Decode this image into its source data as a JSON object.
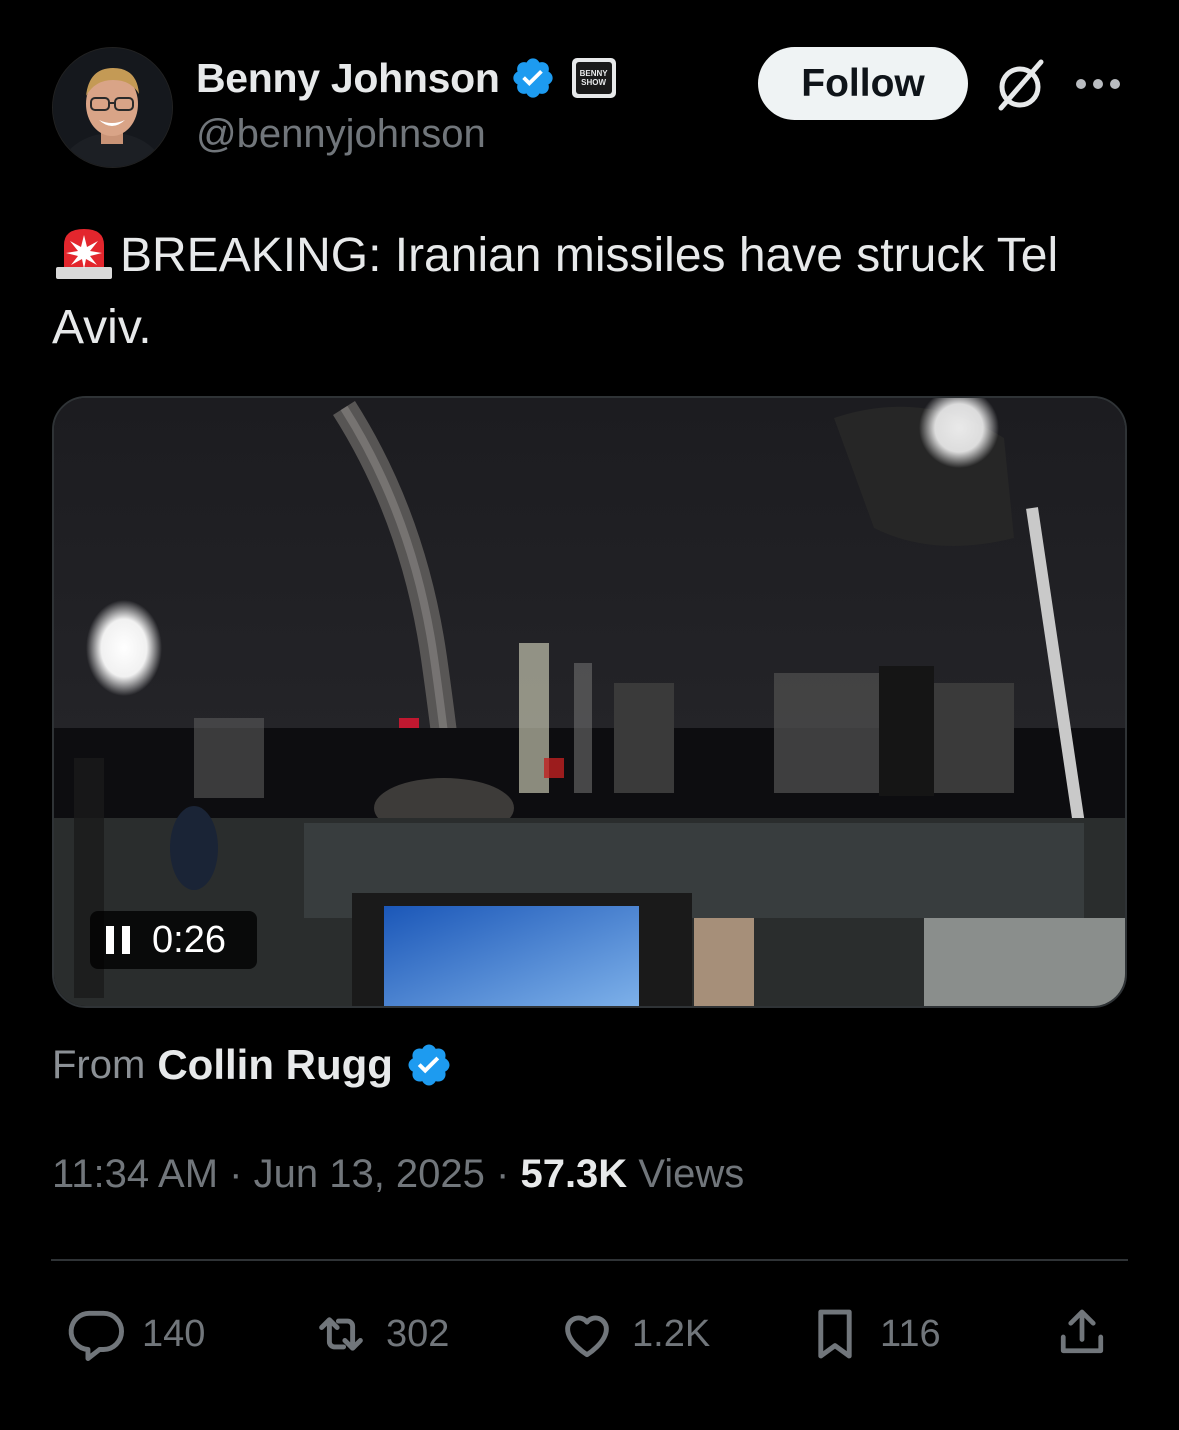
{
  "author": {
    "display_name": "Benny Johnson",
    "handle": "@bennyjohnson",
    "verified_icon": "verified-badge-icon",
    "affiliation_badge_text": "BENNY SHOW",
    "follow_label": "Follow"
  },
  "tweet": {
    "emoji_icon": "rotating-light-icon",
    "text": "BREAKING: Iranian missiles have struck Tel Aviv."
  },
  "video": {
    "elapsed": "0:26",
    "state": "playing"
  },
  "attribution": {
    "from_label": "From",
    "source_name": "Collin Rugg"
  },
  "meta": {
    "time": "11:34 AM",
    "separator": " · ",
    "date": "Jun 13, 2025",
    "views_count": "57.3K",
    "views_label": "Views"
  },
  "actions": {
    "replies": "140",
    "reposts": "302",
    "likes": "1.2K",
    "bookmarks": "116"
  },
  "colors": {
    "background": "#000000",
    "text": "#e7e9ea",
    "secondary_text": "#71767b",
    "verified_blue": "#1d9bf0",
    "divider": "#2f3336"
  }
}
